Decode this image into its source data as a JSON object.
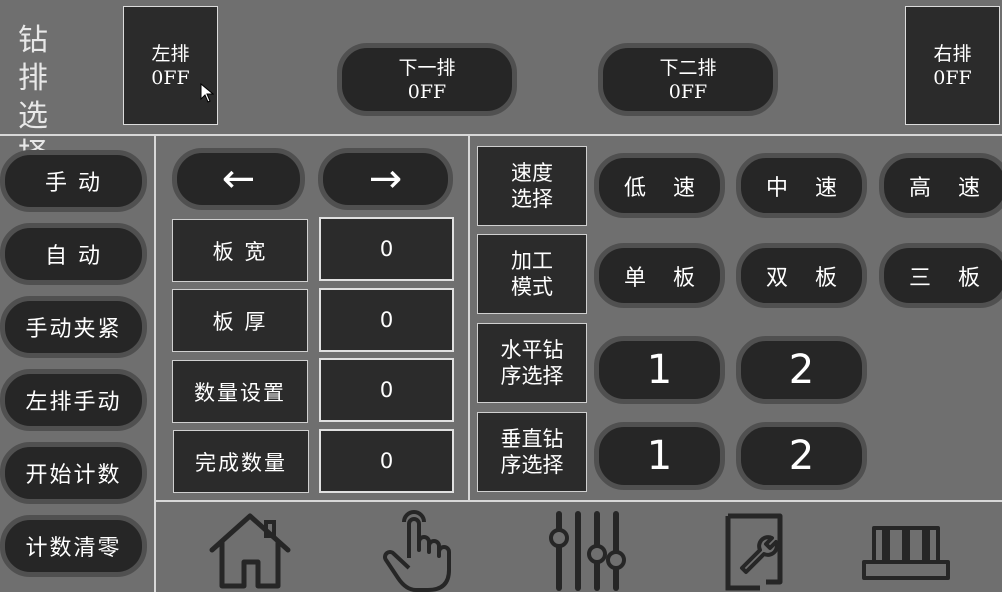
{
  "row_select": {
    "title_line1": "钻 排",
    "title_line2": "选 择",
    "left_row": {
      "label": "左排",
      "state": "0FF"
    },
    "next_row": {
      "label": "下一排",
      "state": "0FF"
    },
    "next_two_row": {
      "label": "下二排",
      "state": "0FF"
    },
    "right_row": {
      "label": "右排",
      "state": "0FF"
    }
  },
  "sidebar": {
    "items": [
      {
        "label": "手 动"
      },
      {
        "label": "自 动"
      },
      {
        "label": "手动夹紧"
      },
      {
        "label": "左排手动"
      },
      {
        "label": "开始计数"
      },
      {
        "label": "计数清零"
      }
    ]
  },
  "arrows": {
    "left": "←",
    "right": "→"
  },
  "params": [
    {
      "label": "板 宽",
      "value": "0"
    },
    {
      "label": "板 厚",
      "value": "0"
    },
    {
      "label": "数量设置",
      "value": "0"
    },
    {
      "label": "完成数量",
      "value": "0"
    }
  ],
  "speed": {
    "category_line1": "速度",
    "category_line2": "选择",
    "options": [
      "低 速",
      "中 速",
      "高 速"
    ]
  },
  "mode": {
    "category_line1": "加工",
    "category_line2": "模式",
    "options": [
      "单 板",
      "双 板",
      "三 板"
    ]
  },
  "horizontal_seq": {
    "category_line1": "水平钻",
    "category_line2": "序选择",
    "options": [
      "1",
      "2"
    ]
  },
  "vertical_seq": {
    "category_line1": "垂直钻",
    "category_line2": "序选择",
    "options": [
      "1",
      "2"
    ]
  },
  "bottom_nav": {
    "icons": [
      "home-icon",
      "touch-hand-icon",
      "sliders-icon",
      "settings-wrench-icon",
      "pallet-icon"
    ]
  },
  "colors": {
    "background": "#6f6f6f",
    "button": "#262626",
    "border": "#d8d8d8"
  }
}
